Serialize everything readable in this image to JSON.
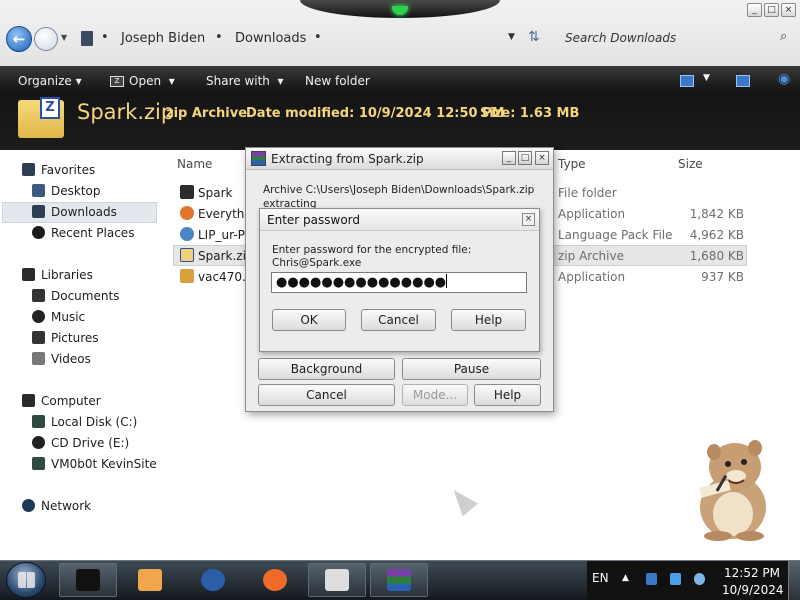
{
  "window": {
    "controls": [
      "_",
      "□",
      "×"
    ]
  },
  "address": {
    "crumbs": [
      "Joseph Biden",
      "Downloads"
    ],
    "search_placeholder": "Search Downloads"
  },
  "toolbar": {
    "organize": "Organize",
    "open": "Open",
    "share_with": "Share with",
    "new_folder": "New folder"
  },
  "details": {
    "file_name": "Spark.zip",
    "file_type": "zip Archive",
    "date_modified": "Date modified: 10/9/2024 12:50 PM",
    "size": "Size: 1.63 MB"
  },
  "navpane": {
    "favorites": "Favorites",
    "desktop": "Desktop",
    "downloads": "Downloads",
    "recent_places": "Recent Places",
    "libraries": "Libraries",
    "documents": "Documents",
    "music": "Music",
    "pictures": "Pictures",
    "videos": "Videos",
    "computer": "Computer",
    "local_disk": "Local Disk (C:)",
    "cd_drive": "CD Drive (E:)",
    "network_drive": "VM0b0t KevinSite",
    "network": "Network"
  },
  "columns": {
    "name": "Name",
    "type": "Type",
    "size": "Size"
  },
  "files": [
    {
      "name": "Spark",
      "type": "File folder",
      "size": ""
    },
    {
      "name": "Everythin",
      "type": "Application",
      "size": "1,842 KB"
    },
    {
      "name": "LIP_ur-Pk",
      "type": "Language Pack File",
      "size": "4,962 KB"
    },
    {
      "name": "Spark.zip",
      "type": "zip Archive",
      "size": "1,680 KB"
    },
    {
      "name": "vac470.ex",
      "type": "Application",
      "size": "937 KB"
    }
  ],
  "extract_dialog": {
    "title": "Extracting from Spark.zip",
    "archive_line": "Archive C:\\Users\\Joseph Biden\\Downloads\\Spark.zip",
    "status_line": "extracting",
    "background": "Background",
    "pause": "Pause",
    "cancel": "Cancel",
    "mode": "Mode...",
    "help": "Help"
  },
  "password_dialog": {
    "title": "Enter password",
    "prompt": "Enter password for the encrypted file:",
    "file": "Chris@Spark.exe",
    "masked_value": "●●●●●●●●●●●●●●●",
    "ok": "OK",
    "cancel": "Cancel",
    "help": "Help"
  },
  "taskbar": {
    "language": "EN",
    "time": "12:52 PM",
    "date": "10/9/2024"
  }
}
